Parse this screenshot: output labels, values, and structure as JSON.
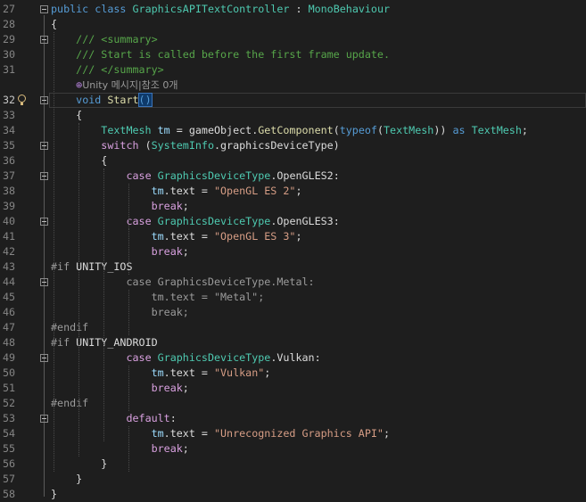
{
  "editor": {
    "lines": [
      {
        "n": "27",
        "fold": true,
        "tokens": [
          [
            "k",
            "public"
          ],
          [
            "p",
            " "
          ],
          [
            "k",
            "class"
          ],
          [
            "p",
            " "
          ],
          [
            "t",
            "GraphicsAPITextController"
          ],
          [
            "p",
            " : "
          ],
          [
            "t",
            "MonoBehaviour"
          ]
        ]
      },
      {
        "n": "28",
        "tokens": [
          [
            "p",
            "{"
          ]
        ]
      },
      {
        "n": "29",
        "fold": true,
        "tokens": [
          [
            "p",
            "    "
          ],
          [
            "c",
            "/// <summary>"
          ]
        ]
      },
      {
        "n": "30",
        "tokens": [
          [
            "p",
            "    "
          ],
          [
            "c",
            "/// Start is called before the first frame update."
          ]
        ]
      },
      {
        "n": "31",
        "tokens": [
          [
            "p",
            "    "
          ],
          [
            "c",
            "/// </summary>"
          ]
        ]
      },
      {
        "n": "",
        "lens": true,
        "tokens": [
          [
            "p",
            "    "
          ],
          [
            "lens-icon",
            "⊕"
          ],
          [
            "lens",
            "Unity 메시지|참조 0개"
          ]
        ]
      },
      {
        "n": "32",
        "fold": true,
        "bulb": true,
        "current": true,
        "tokens": [
          [
            "p",
            "    "
          ],
          [
            "k",
            "void"
          ],
          [
            "p",
            " "
          ],
          [
            "m",
            "Start"
          ],
          [
            "bracematch",
            "()"
          ]
        ]
      },
      {
        "n": "33",
        "tokens": [
          [
            "p",
            "    {"
          ]
        ]
      },
      {
        "n": "34",
        "tokens": [
          [
            "p",
            "        "
          ],
          [
            "t",
            "TextMesh"
          ],
          [
            "p",
            " "
          ],
          [
            "v",
            "tm"
          ],
          [
            "p",
            " = gameObject."
          ],
          [
            "m",
            "GetComponent"
          ],
          [
            "p",
            "("
          ],
          [
            "k",
            "typeof"
          ],
          [
            "p",
            "("
          ],
          [
            "t",
            "TextMesh"
          ],
          [
            "p",
            ")) "
          ],
          [
            "k",
            "as"
          ],
          [
            "p",
            " "
          ],
          [
            "t",
            "TextMesh"
          ],
          [
            "p",
            ";"
          ]
        ]
      },
      {
        "n": "35",
        "fold": true,
        "tokens": [
          [
            "p",
            "        "
          ],
          [
            "ctl",
            "switch"
          ],
          [
            "p",
            " ("
          ],
          [
            "t",
            "SystemInfo"
          ],
          [
            "p",
            ".graphicsDeviceType)"
          ]
        ]
      },
      {
        "n": "36",
        "tokens": [
          [
            "p",
            "        {"
          ]
        ]
      },
      {
        "n": "37",
        "fold": true,
        "tokens": [
          [
            "p",
            "            "
          ],
          [
            "ctl",
            "case"
          ],
          [
            "p",
            " "
          ],
          [
            "t",
            "GraphicsDeviceType"
          ],
          [
            "p",
            ".OpenGLES2:"
          ]
        ]
      },
      {
        "n": "38",
        "tokens": [
          [
            "p",
            "                "
          ],
          [
            "v",
            "tm"
          ],
          [
            "p",
            ".text = "
          ],
          [
            "s",
            "\"OpenGL ES 2\""
          ],
          [
            "p",
            ";"
          ]
        ]
      },
      {
        "n": "39",
        "tokens": [
          [
            "p",
            "                "
          ],
          [
            "ctl",
            "break"
          ],
          [
            "p",
            ";"
          ]
        ]
      },
      {
        "n": "40",
        "fold": true,
        "tokens": [
          [
            "p",
            "            "
          ],
          [
            "ctl",
            "case"
          ],
          [
            "p",
            " "
          ],
          [
            "t",
            "GraphicsDeviceType"
          ],
          [
            "p",
            ".OpenGLES3:"
          ]
        ]
      },
      {
        "n": "41",
        "tokens": [
          [
            "p",
            "                "
          ],
          [
            "v",
            "tm"
          ],
          [
            "p",
            ".text = "
          ],
          [
            "s",
            "\"OpenGL ES 3\""
          ],
          [
            "p",
            ";"
          ]
        ]
      },
      {
        "n": "42",
        "tokens": [
          [
            "p",
            "                "
          ],
          [
            "ctl",
            "break"
          ],
          [
            "p",
            ";"
          ]
        ]
      },
      {
        "n": "43",
        "tokens": [
          [
            "pp",
            "#if"
          ],
          [
            "p",
            " UNITY_IOS"
          ]
        ]
      },
      {
        "n": "44",
        "fold": true,
        "tokens": [
          [
            "p",
            "            "
          ],
          [
            "dim",
            "case GraphicsDeviceType.Metal:"
          ]
        ]
      },
      {
        "n": "45",
        "tokens": [
          [
            "p",
            "                "
          ],
          [
            "dim",
            "tm.text = \"Metal\";"
          ]
        ]
      },
      {
        "n": "46",
        "tokens": [
          [
            "p",
            "                "
          ],
          [
            "dim",
            "break;"
          ]
        ]
      },
      {
        "n": "47",
        "tokens": [
          [
            "pp",
            "#endif"
          ]
        ]
      },
      {
        "n": "48",
        "tokens": [
          [
            "pp",
            "#if"
          ],
          [
            "p",
            " UNITY_ANDROID"
          ]
        ]
      },
      {
        "n": "49",
        "fold": true,
        "tokens": [
          [
            "p",
            "            "
          ],
          [
            "ctl",
            "case"
          ],
          [
            "p",
            " "
          ],
          [
            "t",
            "GraphicsDeviceType"
          ],
          [
            "p",
            ".Vulkan:"
          ]
        ]
      },
      {
        "n": "50",
        "tokens": [
          [
            "p",
            "                "
          ],
          [
            "v",
            "tm"
          ],
          [
            "p",
            ".text = "
          ],
          [
            "s",
            "\"Vulkan\""
          ],
          [
            "p",
            ";"
          ]
        ]
      },
      {
        "n": "51",
        "tokens": [
          [
            "p",
            "                "
          ],
          [
            "ctl",
            "break"
          ],
          [
            "p",
            ";"
          ]
        ]
      },
      {
        "n": "52",
        "tokens": [
          [
            "pp",
            "#endif"
          ]
        ]
      },
      {
        "n": "53",
        "fold": true,
        "tokens": [
          [
            "p",
            "            "
          ],
          [
            "ctl",
            "default"
          ],
          [
            "p",
            ":"
          ]
        ]
      },
      {
        "n": "54",
        "tokens": [
          [
            "p",
            "                "
          ],
          [
            "v",
            "tm"
          ],
          [
            "p",
            ".text = "
          ],
          [
            "s",
            "\"Unrecognized Graphics API\""
          ],
          [
            "p",
            ";"
          ]
        ]
      },
      {
        "n": "55",
        "tokens": [
          [
            "p",
            "                "
          ],
          [
            "ctl",
            "break"
          ],
          [
            "p",
            ";"
          ]
        ]
      },
      {
        "n": "56",
        "tokens": [
          [
            "p",
            "        }"
          ]
        ]
      },
      {
        "n": "57",
        "tokens": [
          [
            "p",
            "    }"
          ]
        ]
      },
      {
        "n": "58",
        "tokens": [
          [
            "p",
            "}"
          ]
        ]
      }
    ]
  },
  "colors": {
    "background": "#1e1e1e",
    "keyword": "#569cd6",
    "control": "#d8a0df",
    "type": "#4ec9b0",
    "method": "#dcdcaa",
    "string": "#d69d85",
    "comment": "#57a64a",
    "variable": "#9cdcfe",
    "preprocessor": "#9b9b9b"
  }
}
